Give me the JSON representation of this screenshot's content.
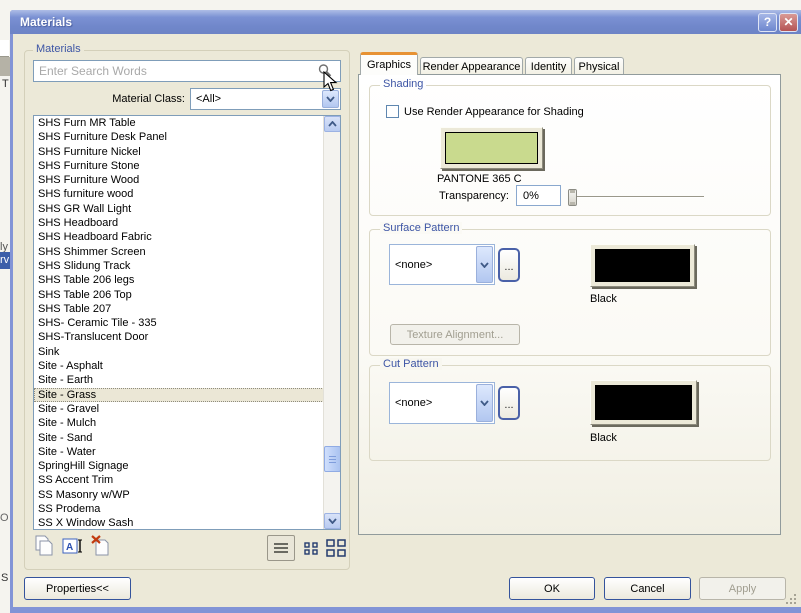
{
  "window": {
    "title": "Materials",
    "help_label": "?",
    "close_label": "✕"
  },
  "background": {
    "fragments": [
      "T",
      "ly",
      "rv",
      "O",
      "S"
    ]
  },
  "left_panel": {
    "group_label": "Materials",
    "search_placeholder": "Enter Search Words",
    "material_class_label": "Material Class:",
    "material_class_value": "<All>",
    "materials": {
      "selected": "Site - Grass",
      "items": [
        "SHS Furn MR Table",
        "SHS Furniture Desk Panel",
        "SHS Furniture Nickel",
        "SHS Furniture Stone",
        "SHS Furniture Wood",
        "SHS furniture wood",
        "SHS GR Wall Light",
        "SHS Headboard",
        "SHS Headboard Fabric",
        "SHS Shimmer Screen",
        "SHS Slidung Track",
        "SHS Table 206 legs",
        "SHS Table 206 Top",
        "SHS Table 207",
        "SHS- Ceramic Tile - 335",
        "SHS-Translucent Door",
        "Sink",
        "Site - Asphalt",
        "Site - Earth",
        "Site - Grass",
        "Site - Gravel",
        "Site - Mulch",
        "Site - Sand",
        "Site - Water",
        "SpringHill Signage",
        "SS Accent Trim",
        "SS Masonry w/WP",
        "SS Prodema",
        "SS X Window Sash"
      ]
    },
    "icons": {
      "search": "magnifier",
      "duplicate": "two-pages",
      "rename": "A-with-ibeam",
      "delete": "page-red-x",
      "view_list": "list-lines",
      "view_small_icons": "small-squares",
      "view_large_icons": "large-squares"
    }
  },
  "tabs": [
    {
      "label": "Graphics",
      "active": true
    },
    {
      "label": "Render Appearance",
      "active": false
    },
    {
      "label": "Identity",
      "active": false
    },
    {
      "label": "Physical",
      "active": false
    }
  ],
  "shading": {
    "label": "Shading",
    "checkbox_label": "Use Render Appearance for Shading",
    "checked": false,
    "color_name": "PANTONE 365 C",
    "color_hex": "#c9da8e",
    "transparency_label": "Transparency:",
    "transparency_value": "0%"
  },
  "surface_pattern": {
    "label": "Surface Pattern",
    "value": "<none>",
    "browse_label": "...",
    "swatch_hex": "#000000",
    "swatch_name": "Black",
    "texture_alignment_label": "Texture Alignment..."
  },
  "cut_pattern": {
    "label": "Cut Pattern",
    "value": "<none>",
    "browse_label": "...",
    "swatch_hex": "#000000",
    "swatch_name": "Black"
  },
  "footer": {
    "properties": "Properties<<",
    "ok": "OK",
    "cancel": "Cancel",
    "apply": "Apply"
  }
}
